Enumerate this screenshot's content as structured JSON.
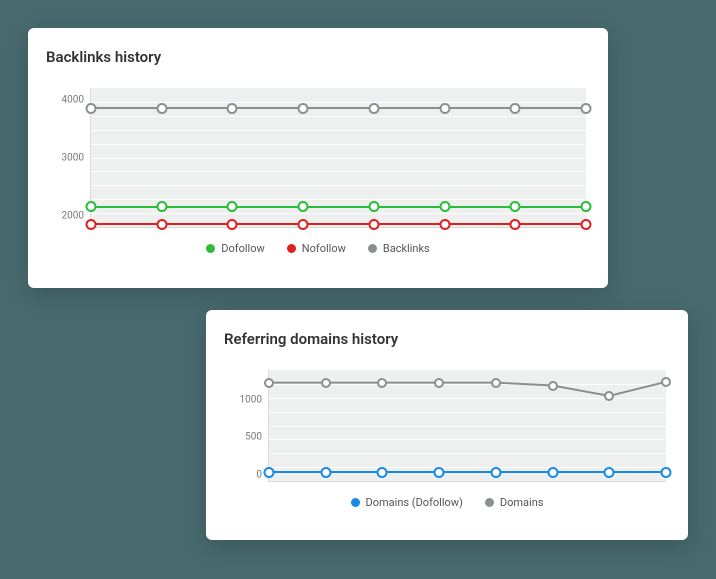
{
  "card1": {
    "title": "Backlinks history",
    "legend": {
      "dofollow": "Dofollow",
      "nofollow": "Nofollow",
      "backlinks": "Backlinks"
    }
  },
  "card2": {
    "title": "Referring domains history",
    "legend": {
      "domains_dofollow": "Domains (Dofollow)",
      "domains": "Domains"
    }
  },
  "colors": {
    "green": "#2bbd3a",
    "red": "#e11f1f",
    "grey": "#8b8f92",
    "blue": "#1789e6"
  },
  "chart_data": [
    {
      "id": "backlinks_history",
      "type": "line",
      "title": "Backlinks history",
      "x": [
        1,
        2,
        3,
        4,
        5,
        6,
        7,
        8
      ],
      "ylim": [
        1800,
        4200
      ],
      "yticks": [
        2000,
        3000,
        4000
      ],
      "grid": true,
      "legend_position": "bottom",
      "series": [
        {
          "name": "Backlinks",
          "color": "#8b8f92",
          "values": [
            3850,
            3850,
            3850,
            3850,
            3850,
            3850,
            3850,
            3850
          ]
        },
        {
          "name": "Dofollow",
          "color": "#2bbd3a",
          "values": [
            2150,
            2150,
            2150,
            2150,
            2150,
            2150,
            2150,
            2150
          ]
        },
        {
          "name": "Nofollow",
          "color": "#e11f1f",
          "values": [
            1850,
            1850,
            1850,
            1850,
            1850,
            1850,
            1850,
            1850
          ]
        }
      ]
    },
    {
      "id": "referring_domains_history",
      "type": "line",
      "title": "Referring domains history",
      "x": [
        1,
        2,
        3,
        4,
        5,
        6,
        7,
        8
      ],
      "ylim": [
        -100,
        1400
      ],
      "yticks": [
        0,
        500,
        1000
      ],
      "grid": true,
      "legend_position": "bottom",
      "series": [
        {
          "name": "Domains",
          "color": "#8b8f92",
          "values": [
            1230,
            1230,
            1230,
            1230,
            1230,
            1190,
            1050,
            1240
          ]
        },
        {
          "name": "Domains (Dofollow)",
          "color": "#1789e6",
          "values": [
            20,
            20,
            20,
            20,
            20,
            20,
            20,
            20
          ]
        }
      ]
    }
  ]
}
